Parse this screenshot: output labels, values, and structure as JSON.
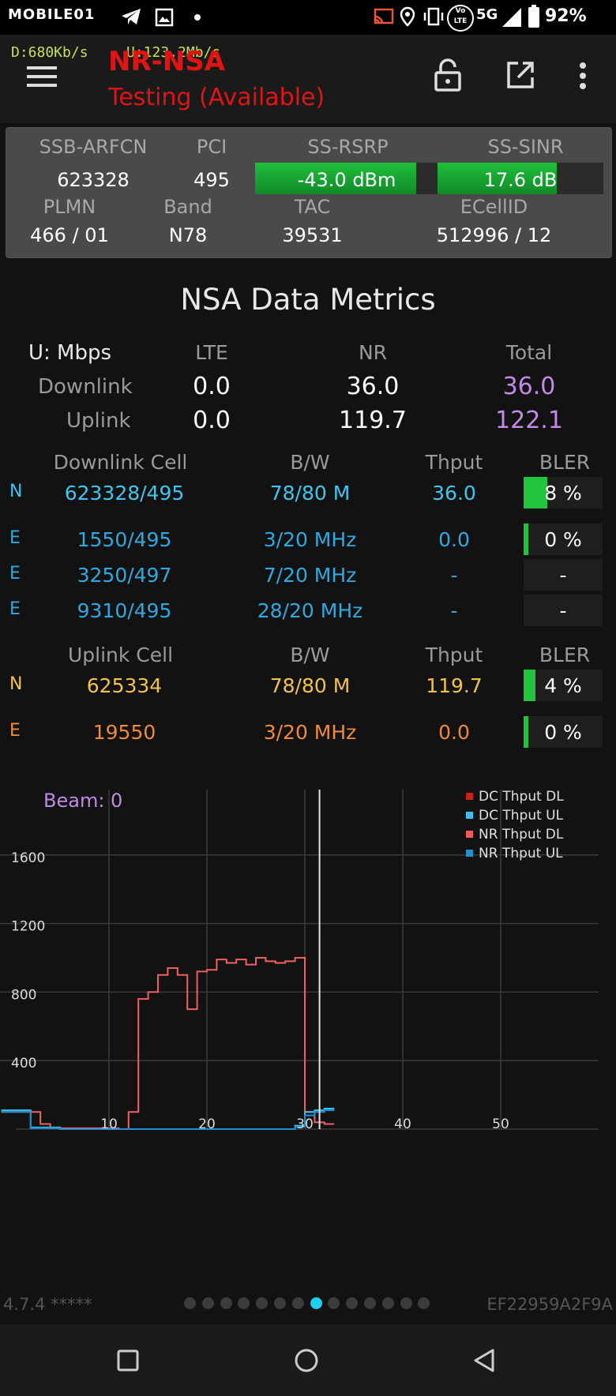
{
  "status_bar": {
    "carrier_logo": "MOBILE01",
    "battery_percent": "92%",
    "network_type": "5G",
    "volte_label": "Vo LTE",
    "icons": [
      "telegram-icon",
      "gallery-icon",
      "dot-icon",
      "cast-icon",
      "location-icon",
      "vibrate-icon",
      "volte-icon",
      "signal-icon",
      "battery-icon"
    ]
  },
  "app_bar": {
    "download_rate": "D:680Kb/s",
    "upload_rate": "U:123.2Mb/s",
    "mode_title": "NR-NSA",
    "status_subtitle": "Testing (Available)"
  },
  "cell_info": {
    "headers_row1": [
      "SSB-ARFCN",
      "PCI",
      "SS-RSRP",
      "SS-SINR"
    ],
    "arfcn": "623328",
    "pci": "495",
    "rsrp": "-43.0 dBm",
    "rsrp_level": 0.88,
    "sinr": "17.6 dB",
    "sinr_level": 0.72,
    "headers_row2": [
      "PLMN",
      "Band",
      "TAC",
      "ECellID"
    ],
    "plmn": "466 / 01",
    "band": "N78",
    "tac": "39531",
    "ecellid": "512996 / 12"
  },
  "metrics": {
    "title": "NSA Data Metrics",
    "unit_label": "U: Mbps",
    "col_lte": "LTE",
    "col_nr": "NR",
    "col_total": "Total",
    "downlink_label": "Downlink",
    "downlink": {
      "lte": "0.0",
      "nr": "36.0",
      "total": "36.0"
    },
    "uplink_label": "Uplink",
    "uplink": {
      "lte": "0.0",
      "nr": "119.7",
      "total": "122.1"
    }
  },
  "downlink_cells": {
    "headers": [
      "Downlink Cell",
      "B/W",
      "Thput",
      "BLER"
    ],
    "rows": [
      {
        "tech": "N",
        "cell": "623328/495",
        "bw": "78/80 M",
        "thput": "36.0",
        "bler": "8 %",
        "bler_level": 0.08
      },
      {
        "tech": "E",
        "cell": "1550/495",
        "bw": "3/20 MHz",
        "thput": "0.0",
        "bler": "0 %",
        "bler_level": 0.0
      },
      {
        "tech": "E",
        "cell": "3250/497",
        "bw": "7/20 MHz",
        "thput": "-",
        "bler": "-",
        "bler_level": null
      },
      {
        "tech": "E",
        "cell": "9310/495",
        "bw": "28/20 MHz",
        "thput": "-",
        "bler": "-",
        "bler_level": null
      }
    ]
  },
  "uplink_cells": {
    "headers": [
      "Uplink Cell",
      "B/W",
      "Thput",
      "BLER"
    ],
    "rows": [
      {
        "tech": "N",
        "cell": "625334",
        "bw": "78/80 M",
        "thput": "119.7",
        "bler": "4 %",
        "bler_level": 0.04
      },
      {
        "tech": "E",
        "cell": "19550",
        "bw": "3/20 MHz",
        "thput": "0.0",
        "bler": "0 %",
        "bler_level": 0.0
      }
    ]
  },
  "chart_data": {
    "type": "line",
    "annotation": "Beam: 0",
    "x_ticks": [
      10,
      20,
      30,
      40,
      50
    ],
    "y_ticks": [
      400,
      800,
      1200,
      1600
    ],
    "xlim": [
      0,
      60
    ],
    "ylim": [
      0,
      2000
    ],
    "cursor_x": 31.5,
    "grid": true,
    "legend_position": "top-right",
    "legend": [
      {
        "name": "DC Thput DL",
        "color": "#c81e1e"
      },
      {
        "name": "DC Thput UL",
        "color": "#3cc0f0"
      },
      {
        "name": "NR Thput DL",
        "color": "#f05a5a"
      },
      {
        "name": "NR Thput UL",
        "color": "#1f8fd0"
      }
    ],
    "series": [
      {
        "legend": "NR Thput DL",
        "color": "#f06060",
        "x": [
          -1,
          3,
          4,
          11,
          12,
          13,
          14,
          15,
          16,
          17,
          18,
          19,
          20,
          21,
          22,
          23,
          24,
          25,
          26,
          27,
          28,
          29,
          30,
          31,
          32,
          33
        ],
        "y": [
          100,
          30,
          5,
          0,
          100,
          760,
          800,
          900,
          940,
          900,
          700,
          920,
          930,
          990,
          970,
          990,
          960,
          1000,
          980,
          970,
          980,
          1000,
          100,
          40,
          30,
          30
        ]
      },
      {
        "legend": "DC Thput UL",
        "color": "#3cc0f0",
        "x": [
          -1,
          1,
          2,
          5,
          10,
          15,
          20,
          25,
          28,
          29,
          30,
          31,
          32,
          33
        ],
        "y": [
          110,
          110,
          10,
          0,
          0,
          0,
          0,
          0,
          0,
          20,
          100,
          110,
          120,
          120
        ]
      },
      {
        "legend": "NR Thput UL",
        "color": "#1f8fd0",
        "x": [
          -1,
          1,
          2,
          5,
          10,
          15,
          20,
          25,
          28,
          29,
          30,
          31,
          32,
          33
        ],
        "y": [
          100,
          100,
          5,
          0,
          0,
          0,
          0,
          0,
          0,
          15,
          80,
          100,
          110,
          110
        ]
      }
    ]
  },
  "footer": {
    "version": "4.7.4 *****",
    "device_id": "EF22959A2F9A",
    "page_count": 14,
    "active_page": 8
  },
  "nav_bar": {
    "recents": "square-recents-icon",
    "home": "circle-home-icon",
    "back": "triangle-back-icon"
  }
}
